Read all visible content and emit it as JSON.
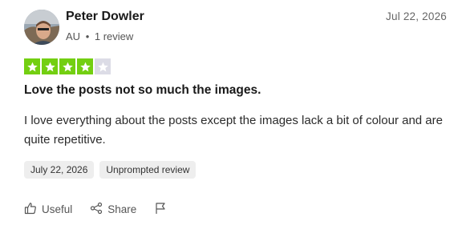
{
  "review": {
    "reviewer": {
      "name": "Peter Dowler",
      "country": "AU",
      "separator": "•",
      "review_count": "1 review"
    },
    "date_header": "Jul 22, 2026",
    "rating": 4,
    "rating_max": 5,
    "title": "Love the posts not so much the images.",
    "body": "I love everything about the posts except the images lack a bit of colour and are quite repetitive.",
    "tags": {
      "date": "July 22, 2026",
      "type": "Unprompted review"
    },
    "actions": {
      "useful": "Useful",
      "share": "Share"
    }
  },
  "colors": {
    "star_filled": "#73cf11",
    "star_empty": "#dcdce6",
    "tag_bg": "#eeeeee"
  },
  "icons": [
    "thumbs-up-icon",
    "share-icon",
    "flag-icon",
    "star-icon"
  ]
}
